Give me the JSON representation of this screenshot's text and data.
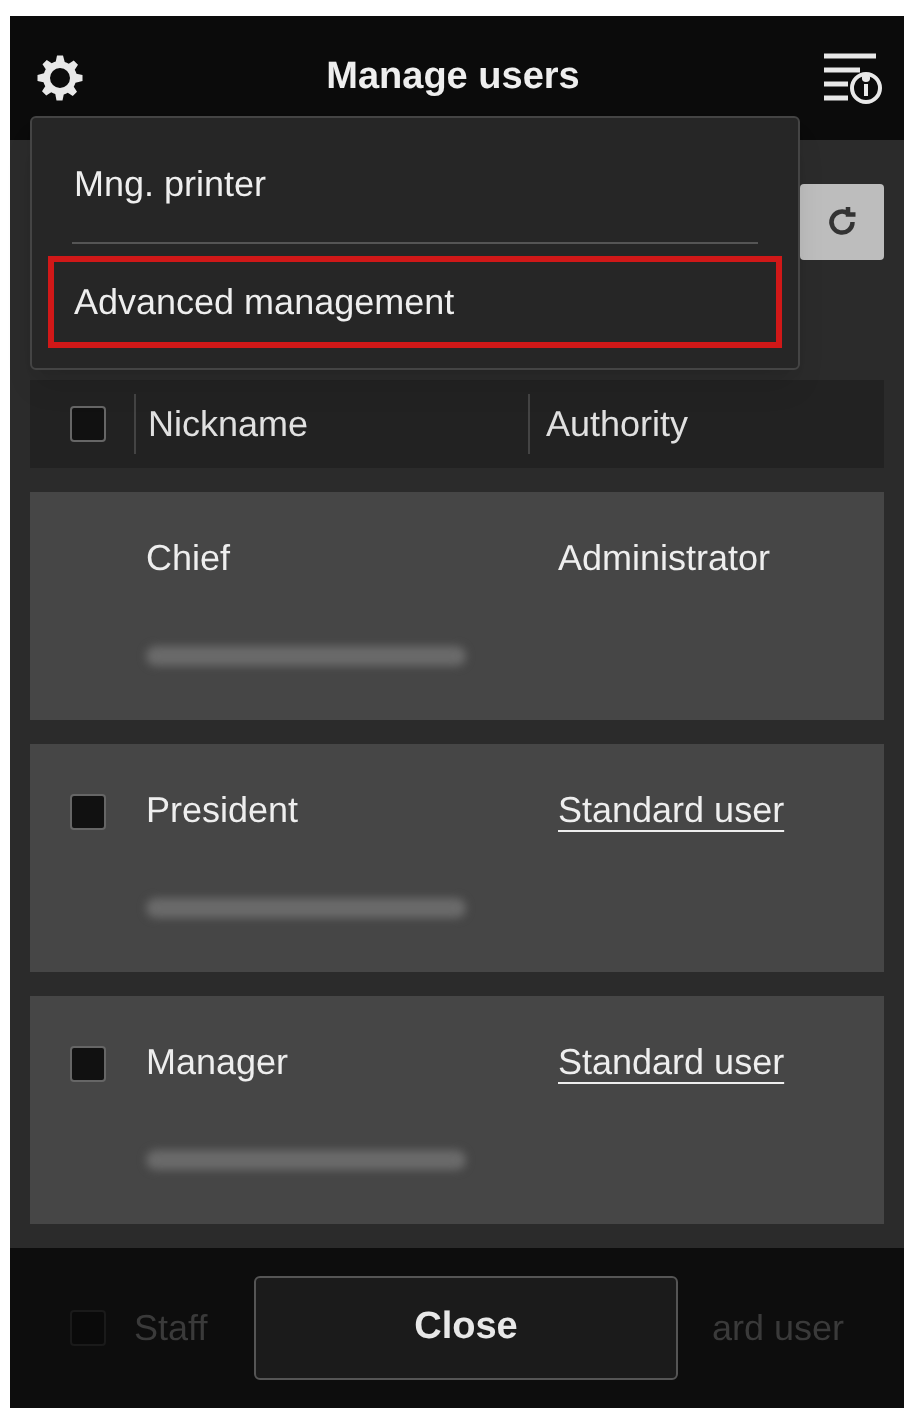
{
  "header": {
    "title": "Manage users"
  },
  "menu": {
    "items": [
      {
        "label": "Mng. printer",
        "selected": false
      },
      {
        "label": "Advanced management",
        "selected": true
      }
    ]
  },
  "table": {
    "header": {
      "checked": false,
      "columns": [
        "Nickname",
        "Authority"
      ]
    },
    "rows": [
      {
        "nickname": "Chief",
        "authority": "Administrator",
        "kind": "plain"
      },
      {
        "nickname": "President",
        "authority": "Standard user",
        "kind": "selectable",
        "checked": false
      },
      {
        "nickname": "Manager",
        "authority": "Standard user",
        "kind": "selectable",
        "checked": false
      }
    ],
    "partial_row": {
      "nickname": "Staff",
      "authority": "ard user",
      "checked": false
    }
  },
  "footer": {
    "button": "Close"
  }
}
